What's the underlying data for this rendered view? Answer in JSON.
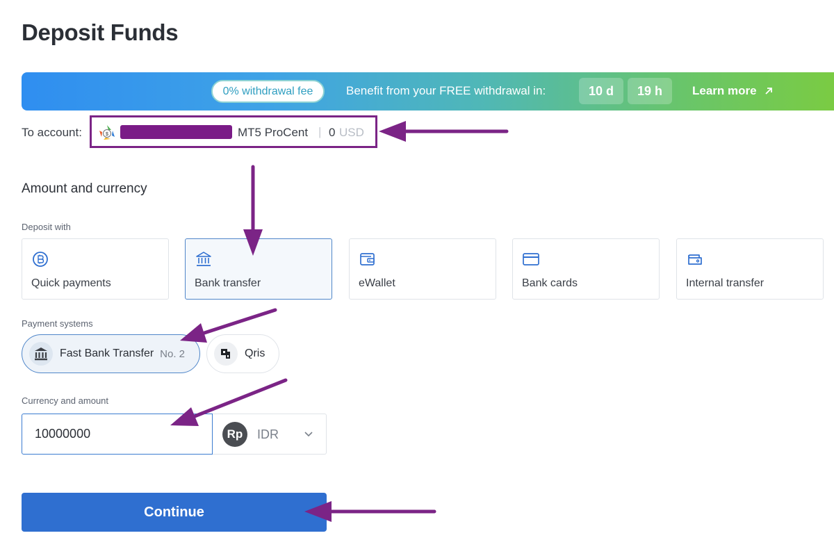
{
  "page": {
    "title": "Deposit Funds"
  },
  "banner": {
    "fee_pill": "0% withdrawal fee",
    "text": "Benefit from your FREE withdrawal in:",
    "days": "10 d",
    "hours": "19 h",
    "learn_more": "Learn more",
    "colors": {
      "gradient_start": "#2f8ef0",
      "gradient_end": "#7ccc3f"
    }
  },
  "account": {
    "label": "To account:",
    "type": "MT5 ProCent",
    "separator": "|",
    "balance": "0",
    "currency": "USD",
    "logo_icon": "metatrader-logo-icon"
  },
  "amount_section": {
    "title": "Amount and currency",
    "deposit_with_label": "Deposit with",
    "methods": [
      {
        "label": "Quick payments",
        "icon": "coin-icon",
        "selected": false
      },
      {
        "label": "Bank transfer",
        "icon": "bank-icon",
        "selected": true
      },
      {
        "label": "eWallet",
        "icon": "wallet-icon",
        "selected": false
      },
      {
        "label": "Bank cards",
        "icon": "card-icon",
        "selected": false
      },
      {
        "label": "Internal transfer",
        "icon": "transfer-wallet-icon",
        "selected": false
      }
    ],
    "payment_systems_label": "Payment systems",
    "payment_systems": [
      {
        "name": "Fast Bank Transfer",
        "badge": "No. 2",
        "icon": "bank-icon",
        "selected": true
      },
      {
        "name": "Qris",
        "badge": "",
        "icon": "qris-icon",
        "selected": false
      }
    ],
    "currency_amount_label": "Currency and amount",
    "amount_value": "10000000",
    "currency_symbol": "Rp",
    "currency_code": "IDR"
  },
  "actions": {
    "continue_label": "Continue"
  },
  "colors": {
    "accent": "#2f6fd0",
    "annotation": "#7b2486"
  }
}
